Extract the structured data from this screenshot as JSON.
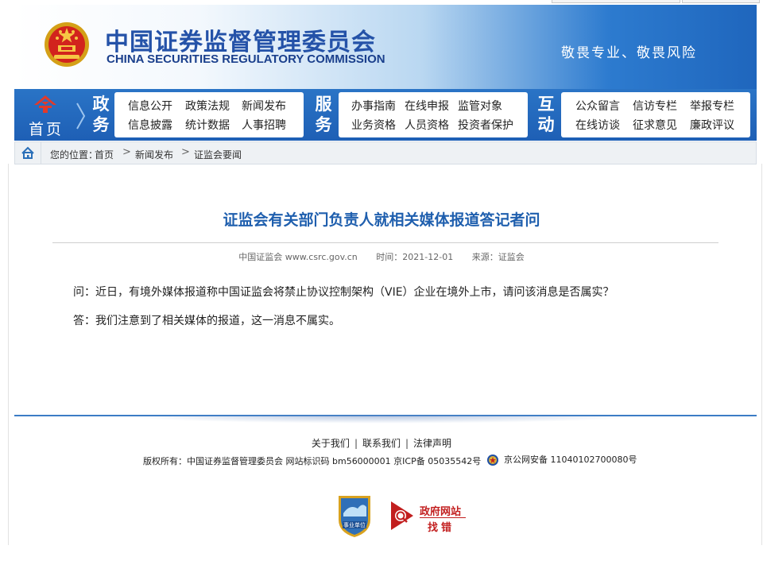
{
  "header": {
    "title_cn": "中国证券监督管理委员会",
    "title_en": "CHINA SECURITIES REGULATORY COMMISSION",
    "slogan": "敬畏专业、敬畏风险"
  },
  "nav": {
    "home_label": "首页",
    "groups": [
      {
        "category": [
          "政",
          "务"
        ],
        "links": [
          "信息公开",
          "政策法规",
          "新闻发布",
          "信息披露",
          "统计数据",
          "人事招聘"
        ]
      },
      {
        "category": [
          "服",
          "务"
        ],
        "links": [
          "办事指南",
          "在线申报",
          "监管对象",
          "业务资格",
          "人员资格",
          "投资者保护"
        ]
      },
      {
        "category": [
          "互",
          "动"
        ],
        "links": [
          "公众留言",
          "信访专栏",
          "举报专栏",
          "在线访谈",
          "征求意见",
          "廉政评议"
        ]
      }
    ]
  },
  "breadcrumb": {
    "prefix": "您的位置：",
    "items": [
      "首页",
      "新闻发布",
      "证监会要闻"
    ],
    "separator": ">"
  },
  "article": {
    "title": "证监会有关部门负责人就相关媒体报道答记者问",
    "site": "中国证监会 www.csrc.gov.cn",
    "date": "时间：2021-12-01",
    "source": "来源：证监会",
    "paragraphs": [
      "问：近日，有境外媒体报道称中国证监会将禁止协议控制架构（VIE）企业在境外上市，请问该消息是否属实？",
      "答：我们注意到了相关媒体的报道，这一消息不属实。"
    ]
  },
  "footer": {
    "links": [
      "关于我们",
      "联系我们",
      "法律声明"
    ],
    "copyright": "版权所有：中国证券监督管理委员会 网站标识码 bm56000001 京ICP备 05035542号",
    "police": "京公网安备 11040102700080号",
    "badge_unit": "事业单位",
    "findbug_line1": "政府网站",
    "findbug_line2": "找错"
  },
  "colors": {
    "brand_blue": "#2452a8",
    "nav_blue": "#1e5fb5",
    "title_blue": "#1f5fae",
    "findbug_red": "#c21f1f"
  }
}
